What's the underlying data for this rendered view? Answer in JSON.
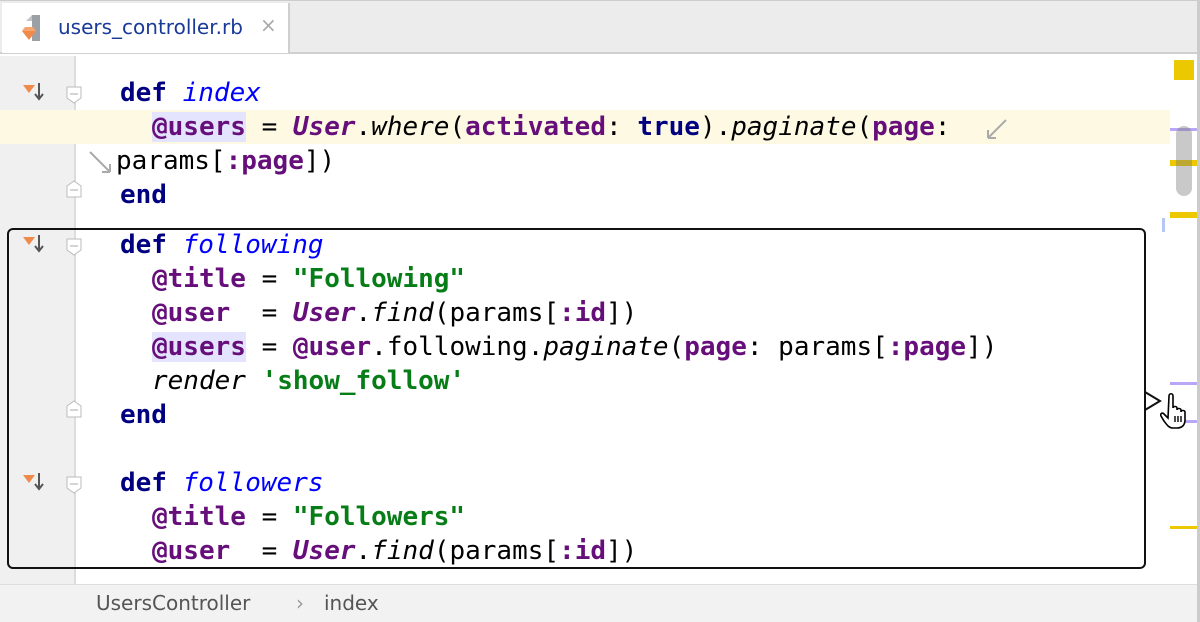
{
  "tab": {
    "filename": "users_controller.rb",
    "icon": "ruby-file-icon",
    "close": "×"
  },
  "breadcrumb": {
    "items": [
      "UsersController",
      "index"
    ],
    "separator": "›"
  },
  "colors": {
    "keyword": "#000080",
    "function": "#0000ff",
    "ivar": "#660e7a",
    "string": "#067d17",
    "current_line": "#fdf9e3"
  },
  "code": [
    [
      [
        "kw",
        "def "
      ],
      [
        "fn",
        "index"
      ]
    ],
    [
      [
        "ivh",
        "@users"
      ],
      [
        "plain",
        " = "
      ],
      [
        "cls",
        "User"
      ],
      [
        "plain",
        "."
      ],
      [
        "mth",
        "where"
      ],
      [
        "plain",
        "("
      ],
      [
        "sym",
        "activated"
      ],
      [
        "plain",
        ": "
      ],
      [
        "kw",
        "true"
      ],
      [
        "plain",
        ")."
      ],
      [
        "mth",
        "paginate"
      ],
      [
        "plain",
        "("
      ],
      [
        "sym",
        "page"
      ],
      [
        "plain",
        ":"
      ]
    ],
    [
      [
        "plain",
        "params["
      ],
      [
        "sym",
        ":page"
      ],
      [
        "plain",
        "])"
      ]
    ],
    [
      [
        "kw",
        "end"
      ]
    ],
    [
      [
        "kw",
        "def "
      ],
      [
        "fn",
        "following"
      ]
    ],
    [
      [
        "iv",
        "@title"
      ],
      [
        "plain",
        " = "
      ],
      [
        "str",
        "\"Following\""
      ]
    ],
    [
      [
        "iv",
        "@user"
      ],
      [
        "plain",
        "  = "
      ],
      [
        "cls",
        "User"
      ],
      [
        "plain",
        "."
      ],
      [
        "mth",
        "find"
      ],
      [
        "plain",
        "(params["
      ],
      [
        "sym",
        ":id"
      ],
      [
        "plain",
        "])"
      ]
    ],
    [
      [
        "ivh",
        "@users"
      ],
      [
        "plain",
        " = "
      ],
      [
        "iv",
        "@user"
      ],
      [
        "plain",
        ".following."
      ],
      [
        "mth",
        "paginate"
      ],
      [
        "plain",
        "("
      ],
      [
        "sym",
        "page"
      ],
      [
        "plain",
        ": params["
      ],
      [
        "sym",
        ":page"
      ],
      [
        "plain",
        "])"
      ]
    ],
    [
      [
        "mth",
        "render "
      ],
      [
        "str",
        "'show_follow'"
      ]
    ],
    [
      [
        "kw",
        "end"
      ]
    ],
    [
      [
        "kw",
        "def "
      ],
      [
        "fn",
        "followers"
      ]
    ],
    [
      [
        "iv",
        "@title"
      ],
      [
        "plain",
        " = "
      ],
      [
        "str",
        "\"Followers\""
      ]
    ],
    [
      [
        "iv",
        "@user"
      ],
      [
        "plain",
        "  = "
      ],
      [
        "cls",
        "User"
      ],
      [
        "plain",
        "."
      ],
      [
        "mth",
        "find"
      ],
      [
        "plain",
        "(params["
      ],
      [
        "sym",
        ":id"
      ],
      [
        "plain",
        "])"
      ]
    ]
  ]
}
